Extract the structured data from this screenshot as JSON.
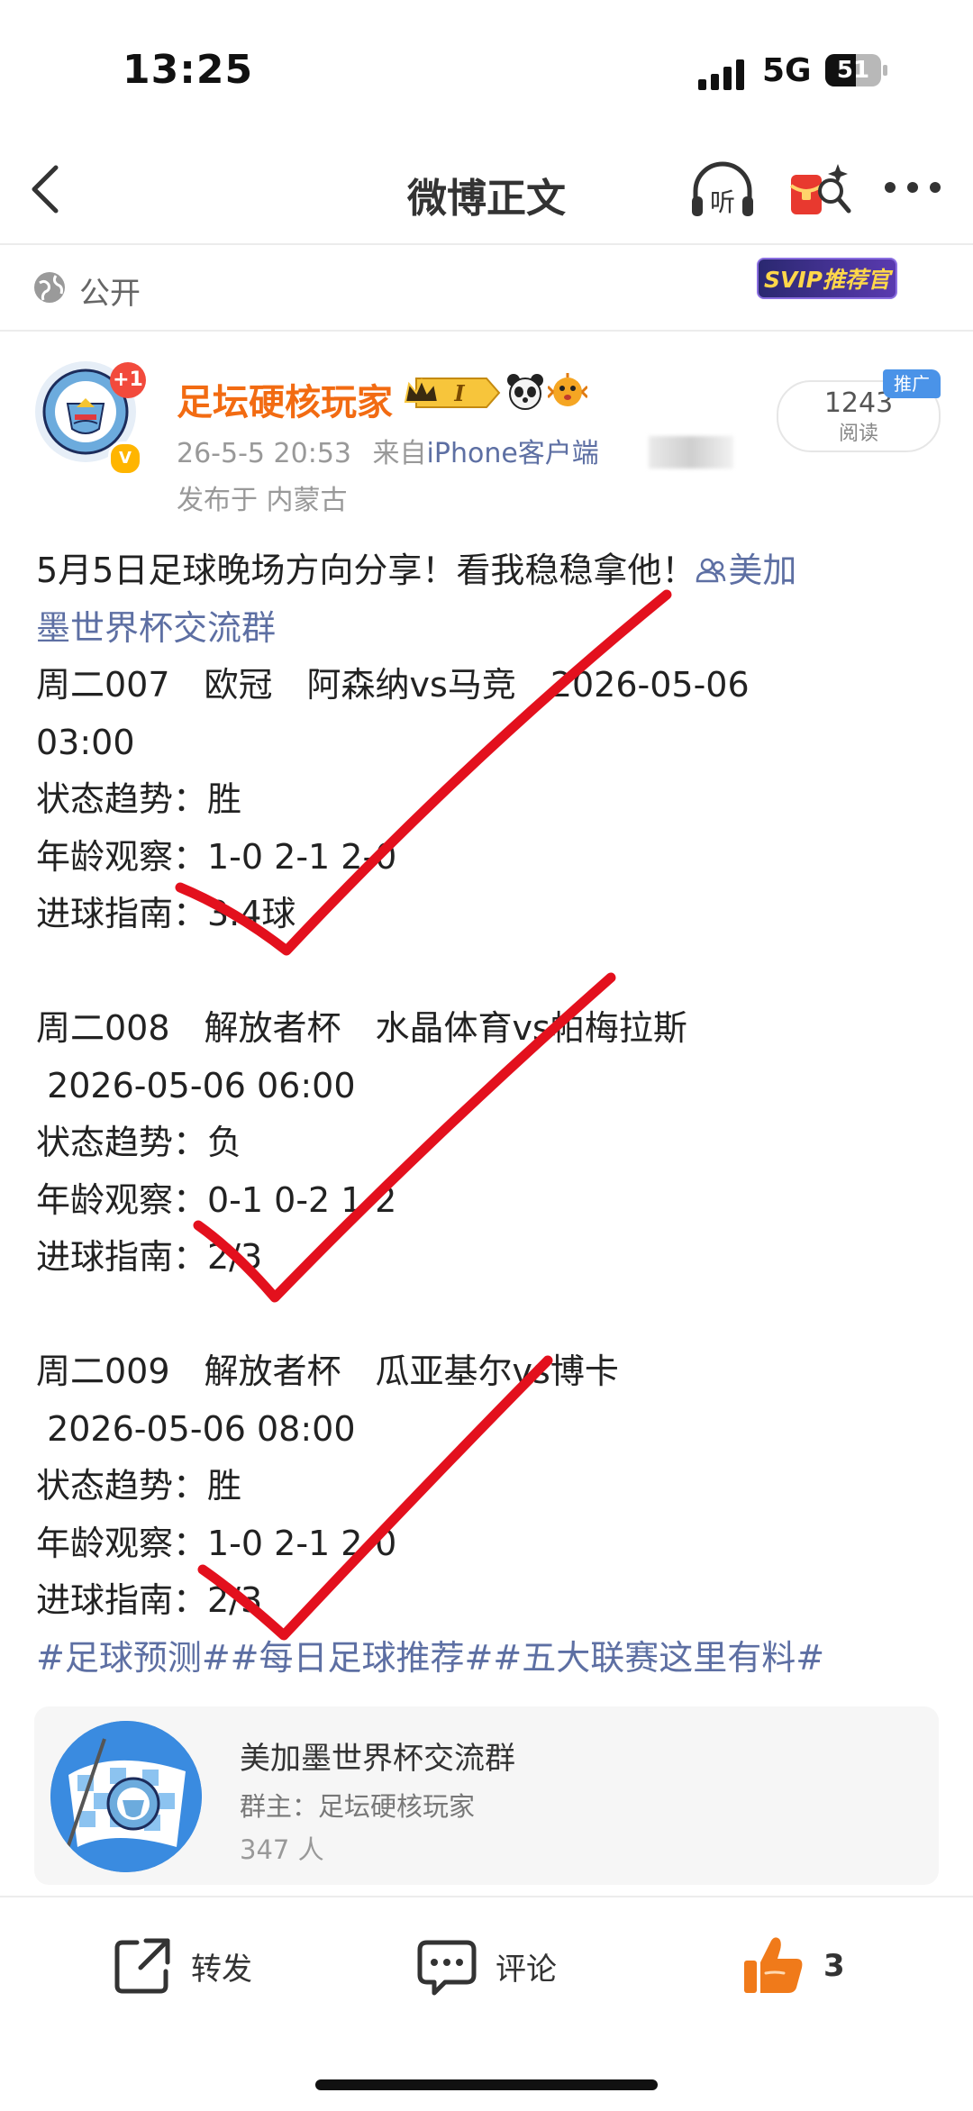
{
  "status_bar": {
    "time": "13:25",
    "network": "5G",
    "battery": "51"
  },
  "nav": {
    "title": "微博正文",
    "listen_label": "听"
  },
  "visibility": {
    "label": "公开",
    "svip_badge": "SVIP推荐官"
  },
  "post": {
    "author": "足坛硬核玩家",
    "avatar_badge": "+1",
    "member_level": "I",
    "datetime": "26-5-5 20:53",
    "source_prefix": "来自",
    "source": "iPhone客户端",
    "location": "发布于 内蒙古",
    "reads": {
      "count": "1243",
      "label": "阅读",
      "promo": "推广"
    },
    "content": {
      "intro": "5月5日足球晚场方向分享！看我稳稳拿他！",
      "group_link_part1": "美加",
      "group_link_part2": "墨世界杯交流群",
      "match1_header": "周二007　欧冠　阿森纳vs马竞　2026-05-06",
      "match1_time": "03:00",
      "match1_trend": "状态趋势：胜",
      "match1_age": "年龄观察：1-0 2-1 2-0",
      "match1_goals": "进球指南：3.4球",
      "match2_header": "周二008　解放者杯　水晶体育vs帕梅拉斯",
      "match2_time": " 2026-05-06 06:00",
      "match2_trend": "状态趋势：负",
      "match2_age": "年龄观察：0-1 0-2 1-2",
      "match2_goals": "进球指南：2/3",
      "match3_header": "周二009　解放者杯　瓜亚基尔vs博卡",
      "match3_time": " 2026-05-06 08:00",
      "match3_trend": "状态趋势：胜",
      "match3_age": "年龄观察：1-0 2-1 2-0",
      "match3_goals": "进球指南：2/3",
      "hashtags": "#足球预测##每日足球推荐##五大联赛这里有料#"
    }
  },
  "group_card": {
    "name": "美加墨世界杯交流群",
    "owner": "群主：足坛硬核玩家",
    "members": "347 人"
  },
  "actions": {
    "repost": "转发",
    "comment": "评论",
    "likes": "3"
  },
  "colors": {
    "username": "#f26b12",
    "link": "#5d6fa3",
    "checkmark": "#e3101d",
    "like": "#f07a1a"
  }
}
